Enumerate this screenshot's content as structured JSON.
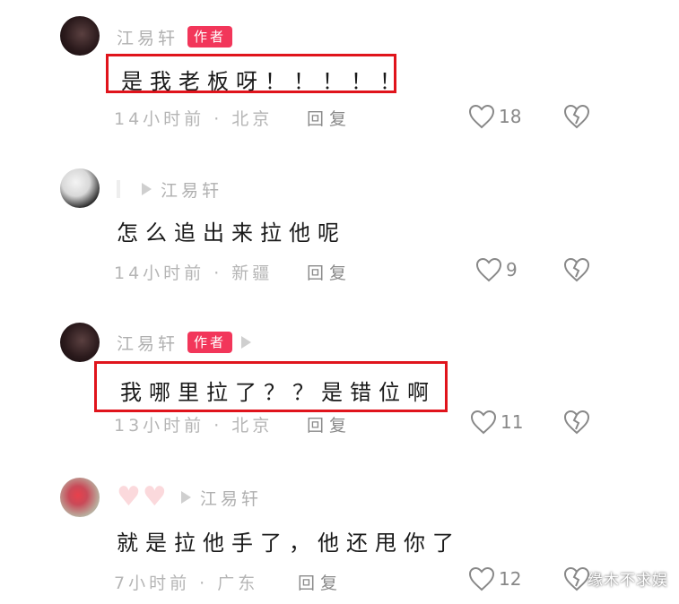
{
  "comments": [
    {
      "username": "江易轩",
      "badge": "作者",
      "content": "是我老板呀！！！！！",
      "meta": "14小时前 · 北京",
      "reply_label": "回复",
      "like_count": "18"
    },
    {
      "username": "江易轩",
      "content": "怎么追出来拉他呢",
      "meta": "14小时前 · 新疆",
      "reply_label": "回复",
      "like_count": "9"
    },
    {
      "username": "江易轩",
      "badge": "作者",
      "content": "我哪里拉了？？是错位啊",
      "meta": "13小时前 · 北京",
      "reply_label": "回复",
      "like_count": "11"
    },
    {
      "username": "江易轩",
      "content": "就是拉他手了，他还甩你了",
      "meta": "7小时前 · 广东",
      "reply_label": "回复",
      "like_count": "12"
    }
  ],
  "watermark": "缘木不求娱",
  "colors": {
    "author_badge": "#f2365a",
    "highlight_box": "#e0141c"
  },
  "icons": {
    "like": "heart-outline-icon",
    "dislike": "broken-heart-icon",
    "reply_arrow": "play-arrow-icon"
  }
}
